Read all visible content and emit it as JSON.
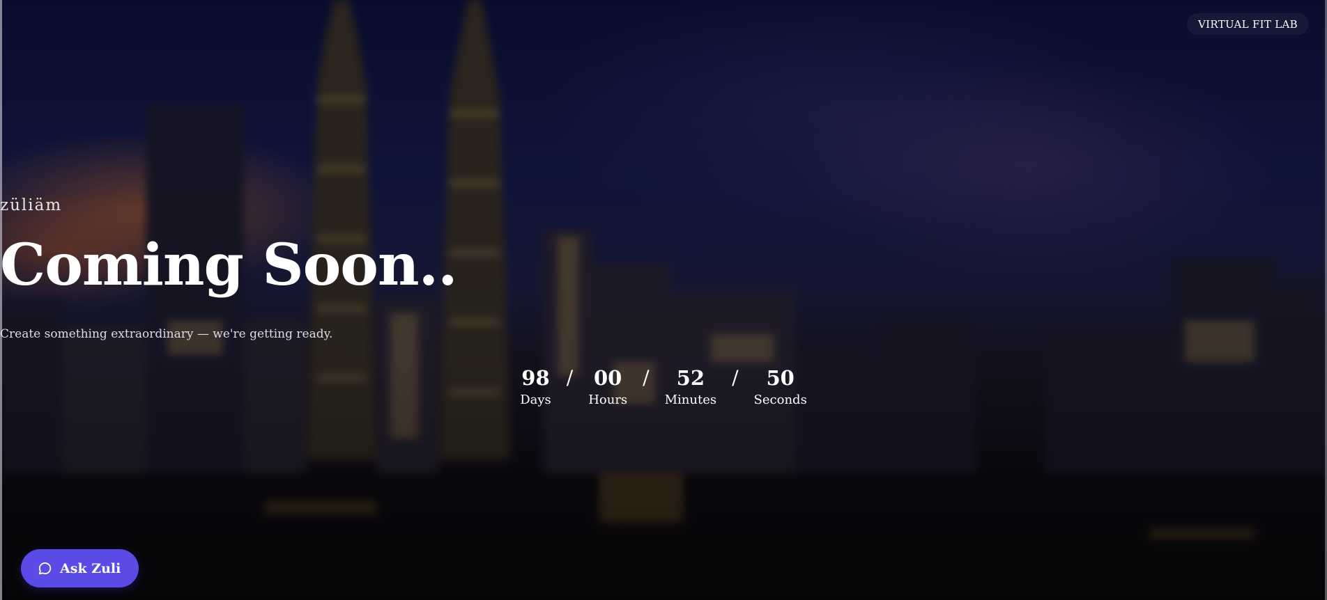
{
  "badge": {
    "label": "VIRTUAL FIT LAB"
  },
  "hero": {
    "brand": "züliäm",
    "headline": "Coming Soon..",
    "subtitle": "Create something extraordinary — we're getting ready."
  },
  "countdown": {
    "days": {
      "value": "98",
      "label": "Days"
    },
    "hours": {
      "value": "00",
      "label": "Hours"
    },
    "minutes": {
      "value": "52",
      "label": "Minutes"
    },
    "seconds": {
      "value": "50",
      "label": "Seconds"
    },
    "separator": "/"
  },
  "chat_button": {
    "label": "Ask Zuli",
    "icon": "chat-bubble-icon",
    "color": "#5a4ae6"
  }
}
